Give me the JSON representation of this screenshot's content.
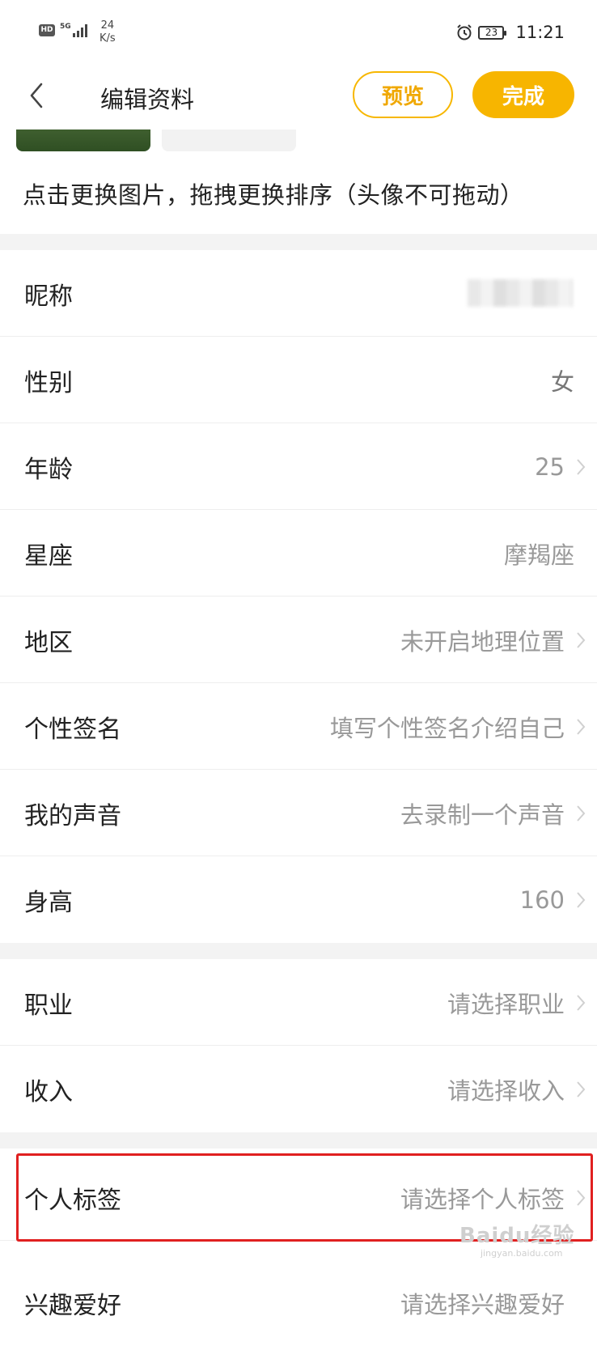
{
  "status_bar": {
    "hd": "HD",
    "signal": "5G",
    "speed_value": "24",
    "speed_unit": "K/s",
    "battery": "23",
    "time": "11:21"
  },
  "header": {
    "title": "编辑资料",
    "preview_label": "预览",
    "done_label": "完成"
  },
  "photo_hint": "点击更换图片，拖拽更换排序（头像不可拖动）",
  "profile_rows": [
    {
      "label": "昵称",
      "value": ""
    },
    {
      "label": "性别",
      "value": "女"
    },
    {
      "label": "年龄",
      "value": "25"
    },
    {
      "label": "星座",
      "value": "摩羯座"
    },
    {
      "label": "地区",
      "value": "未开启地理位置"
    },
    {
      "label": "个性签名",
      "value": "填写个性签名介绍自己"
    },
    {
      "label": "我的声音",
      "value": "去录制一个声音"
    },
    {
      "label": "身高",
      "value": "160"
    }
  ],
  "extra_rows": [
    {
      "label": "职业",
      "value": "请选择职业"
    },
    {
      "label": "收入",
      "value": "请选择收入"
    }
  ],
  "tag_rows": [
    {
      "label": "个人标签",
      "value": "请选择个人标签"
    },
    {
      "label": "兴趣爱好",
      "value": "请选择兴趣爱好"
    }
  ],
  "watermark": {
    "brand": "Baidu经验",
    "url": "jingyan.baidu.com"
  }
}
